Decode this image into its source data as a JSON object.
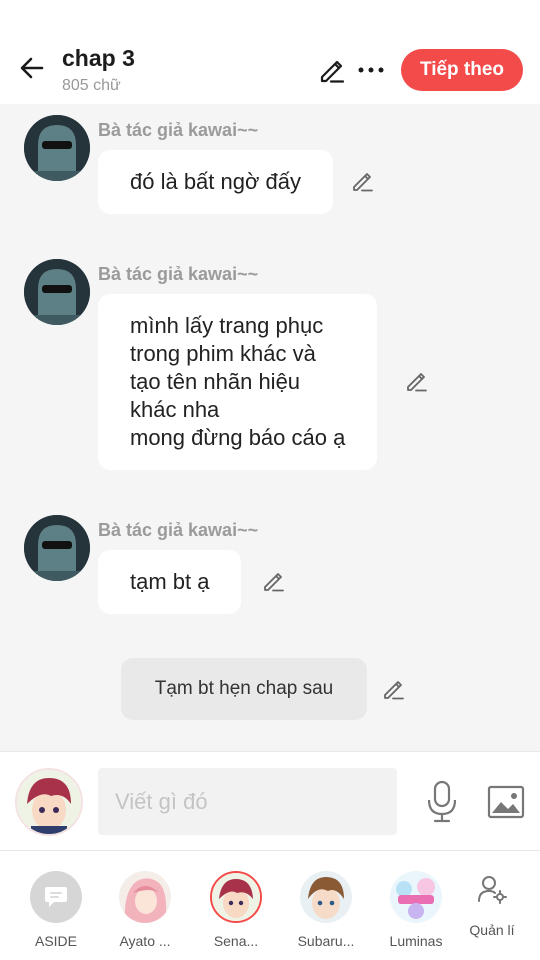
{
  "header": {
    "title": "chap 3",
    "subtitle": "805 chữ",
    "next_label": "Tiếp theo"
  },
  "messages": [
    {
      "author": "Bà tác giả kawai~~",
      "lines": [
        "đó là bất ngờ đấy"
      ]
    },
    {
      "author": "Bà tác giả kawai~~",
      "lines": [
        "mình lấy trang phục",
        "trong phim khác và",
        "tạo tên nhãn hiệu",
        "khác nha",
        "mong đừng báo cáo ạ"
      ]
    },
    {
      "author": "Bà tác giả kawai~~",
      "lines": [
        "tạm bt ạ"
      ]
    }
  ],
  "narration": {
    "text": "Tạm bt hẹn chap sau"
  },
  "composer": {
    "placeholder": "Viết gì đó"
  },
  "characters": [
    {
      "label": "ASIDE"
    },
    {
      "label": "Ayato ..."
    },
    {
      "label": "Sena..."
    },
    {
      "label": "Subaru..."
    },
    {
      "label": "Luminas"
    }
  ],
  "manage": {
    "label": "Quản lí"
  },
  "colors": {
    "accent": "#f34a4a",
    "background": "#f5f5f5",
    "bubble": "#ffffff",
    "narration": "#e9e9e9"
  },
  "icons": [
    "back-arrow-icon",
    "pencil-icon",
    "more-dots-icon",
    "microphone-icon",
    "image-icon",
    "manage-user-icon",
    "chat-bubble-icon"
  ]
}
